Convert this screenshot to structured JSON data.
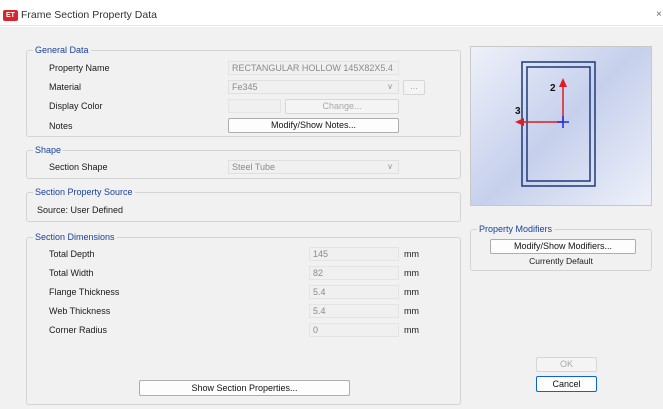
{
  "window": {
    "app_icon_text": "ET",
    "title": "Frame Section Property Data",
    "close_glyph": "×"
  },
  "general": {
    "legend": "General Data",
    "property_name_label": "Property Name",
    "property_name_value": "RECTANGULAR HOLLOW 145X82X5.4",
    "material_label": "Material",
    "material_value": "Fe345",
    "material_more": "...",
    "display_color_label": "Display Color",
    "change_button": "Change...",
    "notes_label": "Notes",
    "notes_button": "Modify/Show Notes..."
  },
  "shape": {
    "legend": "Shape",
    "section_shape_label": "Section Shape",
    "section_shape_value": "Steel Tube"
  },
  "source": {
    "legend": "Section Property Source",
    "text": "Source:  User Defined"
  },
  "dimensions": {
    "legend": "Section Dimensions",
    "rows": [
      {
        "label": "Total Depth",
        "value": "145",
        "unit": "mm"
      },
      {
        "label": "Total Width",
        "value": "82",
        "unit": "mm"
      },
      {
        "label": "Flange Thickness",
        "value": "5.4",
        "unit": "mm"
      },
      {
        "label": "Web Thickness",
        "value": "5.4",
        "unit": "mm"
      },
      {
        "label": "Corner Radius",
        "value": "0",
        "unit": "mm"
      }
    ],
    "show_properties_button": "Show Section Properties..."
  },
  "preview": {
    "axis2_label": "2",
    "axis3_label": "3",
    "colors": {
      "section": "#1d3a7a",
      "axis": "#e01b24",
      "centroid": "#1e2fd8"
    }
  },
  "modifiers": {
    "legend": "Property Modifiers",
    "button": "Modify/Show Modifiers...",
    "status": "Currently Default"
  },
  "footer": {
    "ok_button": "OK",
    "cancel_button": "Cancel"
  }
}
